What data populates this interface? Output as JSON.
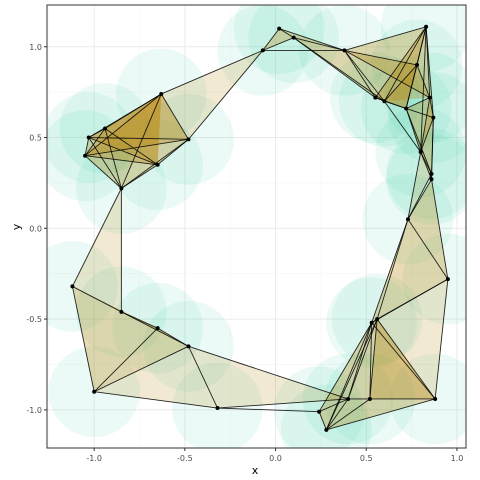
{
  "chart_data": {
    "type": "scatter",
    "title": "",
    "xlabel": "x",
    "ylabel": "y",
    "xlim": [
      -1.26,
      1.05
    ],
    "ylim": [
      -1.21,
      1.23
    ],
    "xticks": [
      -1.0,
      -0.5,
      0.0,
      0.5,
      1.0
    ],
    "yticks": [
      -1.0,
      -0.5,
      0.0,
      0.5,
      1.0
    ],
    "xtick_labels": [
      "-1.0",
      "-0.5",
      "0.0",
      "0.5",
      "1.0"
    ],
    "ytick_labels": [
      "-1.0",
      "-0.5",
      "0.0",
      "0.5",
      "1.0"
    ],
    "grid": true,
    "legend": "none",
    "disk_radius": 0.25,
    "colors": {
      "disk": "#3fd0a4",
      "triangle": "#b8860b",
      "edge": "#000000",
      "point": "#000000",
      "panel_border": "#333333",
      "grid_major": "#ebebeb",
      "grid_minor": "#f5f5f5"
    },
    "points": [
      {
        "x": -1.12,
        "y": -0.32
      },
      {
        "x": -1.0,
        "y": -0.9
      },
      {
        "x": -0.85,
        "y": -0.46
      },
      {
        "x": -0.65,
        "y": -0.55
      },
      {
        "x": -0.48,
        "y": -0.65
      },
      {
        "x": -0.32,
        "y": -0.99
      },
      {
        "x": -0.85,
        "y": 0.22
      },
      {
        "x": -1.05,
        "y": 0.4
      },
      {
        "x": -1.03,
        "y": 0.5
      },
      {
        "x": -0.94,
        "y": 0.55
      },
      {
        "x": -0.63,
        "y": 0.74
      },
      {
        "x": -0.48,
        "y": 0.49
      },
      {
        "x": -0.65,
        "y": 0.35
      },
      {
        "x": -0.07,
        "y": 0.98
      },
      {
        "x": 0.02,
        "y": 1.1
      },
      {
        "x": 0.1,
        "y": 1.05
      },
      {
        "x": 0.38,
        "y": 0.98
      },
      {
        "x": 0.55,
        "y": 0.72
      },
      {
        "x": 0.6,
        "y": 0.7
      },
      {
        "x": 0.72,
        "y": 0.66
      },
      {
        "x": 0.78,
        "y": 0.9
      },
      {
        "x": 0.83,
        "y": 1.11
      },
      {
        "x": 0.85,
        "y": 0.72
      },
      {
        "x": 0.87,
        "y": 0.61
      },
      {
        "x": 0.8,
        "y": 0.42
      },
      {
        "x": 0.86,
        "y": 0.3
      },
      {
        "x": 0.86,
        "y": 0.27
      },
      {
        "x": 0.73,
        "y": 0.05
      },
      {
        "x": 0.95,
        "y": -0.28
      },
      {
        "x": 0.53,
        "y": -0.52
      },
      {
        "x": 0.56,
        "y": -0.5
      },
      {
        "x": 0.52,
        "y": -0.94
      },
      {
        "x": 0.88,
        "y": -0.94
      },
      {
        "x": 0.4,
        "y": -0.94
      },
      {
        "x": 0.24,
        "y": -1.01
      },
      {
        "x": 0.28,
        "y": -1.11
      }
    ],
    "filled_triangles": [
      [
        0,
        1,
        2
      ],
      [
        1,
        2,
        3
      ],
      [
        2,
        3,
        4
      ],
      [
        1,
        3,
        4
      ],
      [
        0,
        2,
        3
      ],
      [
        6,
        7,
        8
      ],
      [
        6,
        8,
        9
      ],
      [
        6,
        9,
        10
      ],
      [
        6,
        10,
        11
      ],
      [
        9,
        10,
        11
      ],
      [
        7,
        10,
        12
      ],
      [
        8,
        10,
        12
      ],
      [
        6,
        11,
        12
      ],
      [
        7,
        9,
        11
      ],
      [
        13,
        14,
        15
      ],
      [
        14,
        15,
        16
      ],
      [
        15,
        16,
        17
      ],
      [
        16,
        17,
        18
      ],
      [
        16,
        18,
        21
      ],
      [
        18,
        19,
        21
      ],
      [
        19,
        20,
        21
      ],
      [
        20,
        21,
        22
      ],
      [
        19,
        22,
        23
      ],
      [
        18,
        20,
        22
      ],
      [
        17,
        19,
        21
      ],
      [
        16,
        20,
        22
      ],
      [
        21,
        22,
        23
      ],
      [
        22,
        23,
        24
      ],
      [
        23,
        24,
        25
      ],
      [
        24,
        25,
        26
      ],
      [
        19,
        23,
        24
      ],
      [
        23,
        25,
        26
      ],
      [
        19,
        24,
        25
      ],
      [
        26,
        27,
        28
      ],
      [
        27,
        28,
        29
      ],
      [
        28,
        29,
        30
      ],
      [
        29,
        30,
        32
      ],
      [
        29,
        31,
        32
      ],
      [
        31,
        32,
        35
      ],
      [
        31,
        33,
        35
      ],
      [
        33,
        34,
        35
      ],
      [
        29,
        31,
        33
      ],
      [
        30,
        31,
        32
      ],
      [
        29,
        33,
        34
      ]
    ],
    "light_triangles": [
      [
        5,
        4,
        33
      ],
      [
        4,
        5,
        1
      ],
      [
        0,
        6,
        2
      ],
      [
        11,
        13,
        10
      ],
      [
        13,
        14,
        11
      ],
      [
        25,
        27,
        24
      ],
      [
        28,
        32,
        30
      ]
    ],
    "edges": [
      [
        0,
        6
      ],
      [
        0,
        2
      ],
      [
        0,
        1
      ],
      [
        2,
        6
      ],
      [
        3,
        4
      ],
      [
        4,
        5
      ],
      [
        1,
        5
      ],
      [
        1,
        3
      ],
      [
        2,
        4
      ],
      [
        1,
        4
      ],
      [
        2,
        3
      ],
      [
        6,
        7
      ],
      [
        6,
        8
      ],
      [
        6,
        9
      ],
      [
        6,
        10
      ],
      [
        6,
        11
      ],
      [
        6,
        12
      ],
      [
        7,
        8
      ],
      [
        8,
        9
      ],
      [
        9,
        10
      ],
      [
        10,
        11
      ],
      [
        11,
        12
      ],
      [
        7,
        12
      ],
      [
        8,
        12
      ],
      [
        7,
        10
      ],
      [
        8,
        11
      ],
      [
        7,
        11
      ],
      [
        9,
        12
      ],
      [
        7,
        9
      ],
      [
        8,
        10
      ],
      [
        10,
        13
      ],
      [
        11,
        13
      ],
      [
        13,
        14
      ],
      [
        13,
        15
      ],
      [
        14,
        15
      ],
      [
        13,
        16
      ],
      [
        14,
        16
      ],
      [
        15,
        16
      ],
      [
        15,
        17
      ],
      [
        16,
        17
      ],
      [
        16,
        18
      ],
      [
        17,
        18
      ],
      [
        15,
        18
      ],
      [
        16,
        21
      ],
      [
        18,
        21
      ],
      [
        17,
        21
      ],
      [
        19,
        21
      ],
      [
        20,
        21
      ],
      [
        21,
        22
      ],
      [
        18,
        20
      ],
      [
        20,
        22
      ],
      [
        19,
        22
      ],
      [
        18,
        19
      ],
      [
        17,
        19
      ],
      [
        16,
        20
      ],
      [
        16,
        22
      ],
      [
        19,
        20
      ],
      [
        21,
        23
      ],
      [
        22,
        23
      ],
      [
        19,
        23
      ],
      [
        23,
        24
      ],
      [
        22,
        24
      ],
      [
        24,
        25
      ],
      [
        23,
        25
      ],
      [
        25,
        26
      ],
      [
        24,
        26
      ],
      [
        23,
        26
      ],
      [
        19,
        24
      ],
      [
        19,
        25
      ],
      [
        18,
        24
      ],
      [
        21,
        24
      ],
      [
        26,
        27
      ],
      [
        25,
        27
      ],
      [
        24,
        27
      ],
      [
        27,
        28
      ],
      [
        26,
        28
      ],
      [
        27,
        29
      ],
      [
        28,
        29
      ],
      [
        28,
        30
      ],
      [
        27,
        30
      ],
      [
        29,
        30
      ],
      [
        28,
        32
      ],
      [
        30,
        32
      ],
      [
        29,
        32
      ],
      [
        29,
        31
      ],
      [
        30,
        31
      ],
      [
        31,
        32
      ],
      [
        31,
        33
      ],
      [
        31,
        35
      ],
      [
        32,
        35
      ],
      [
        33,
        35
      ],
      [
        33,
        34
      ],
      [
        34,
        35
      ],
      [
        29,
        33
      ],
      [
        29,
        34
      ],
      [
        30,
        33
      ],
      [
        29,
        35
      ],
      [
        30,
        35
      ],
      [
        5,
        34
      ],
      [
        5,
        33
      ],
      [
        4,
        33
      ]
    ]
  }
}
